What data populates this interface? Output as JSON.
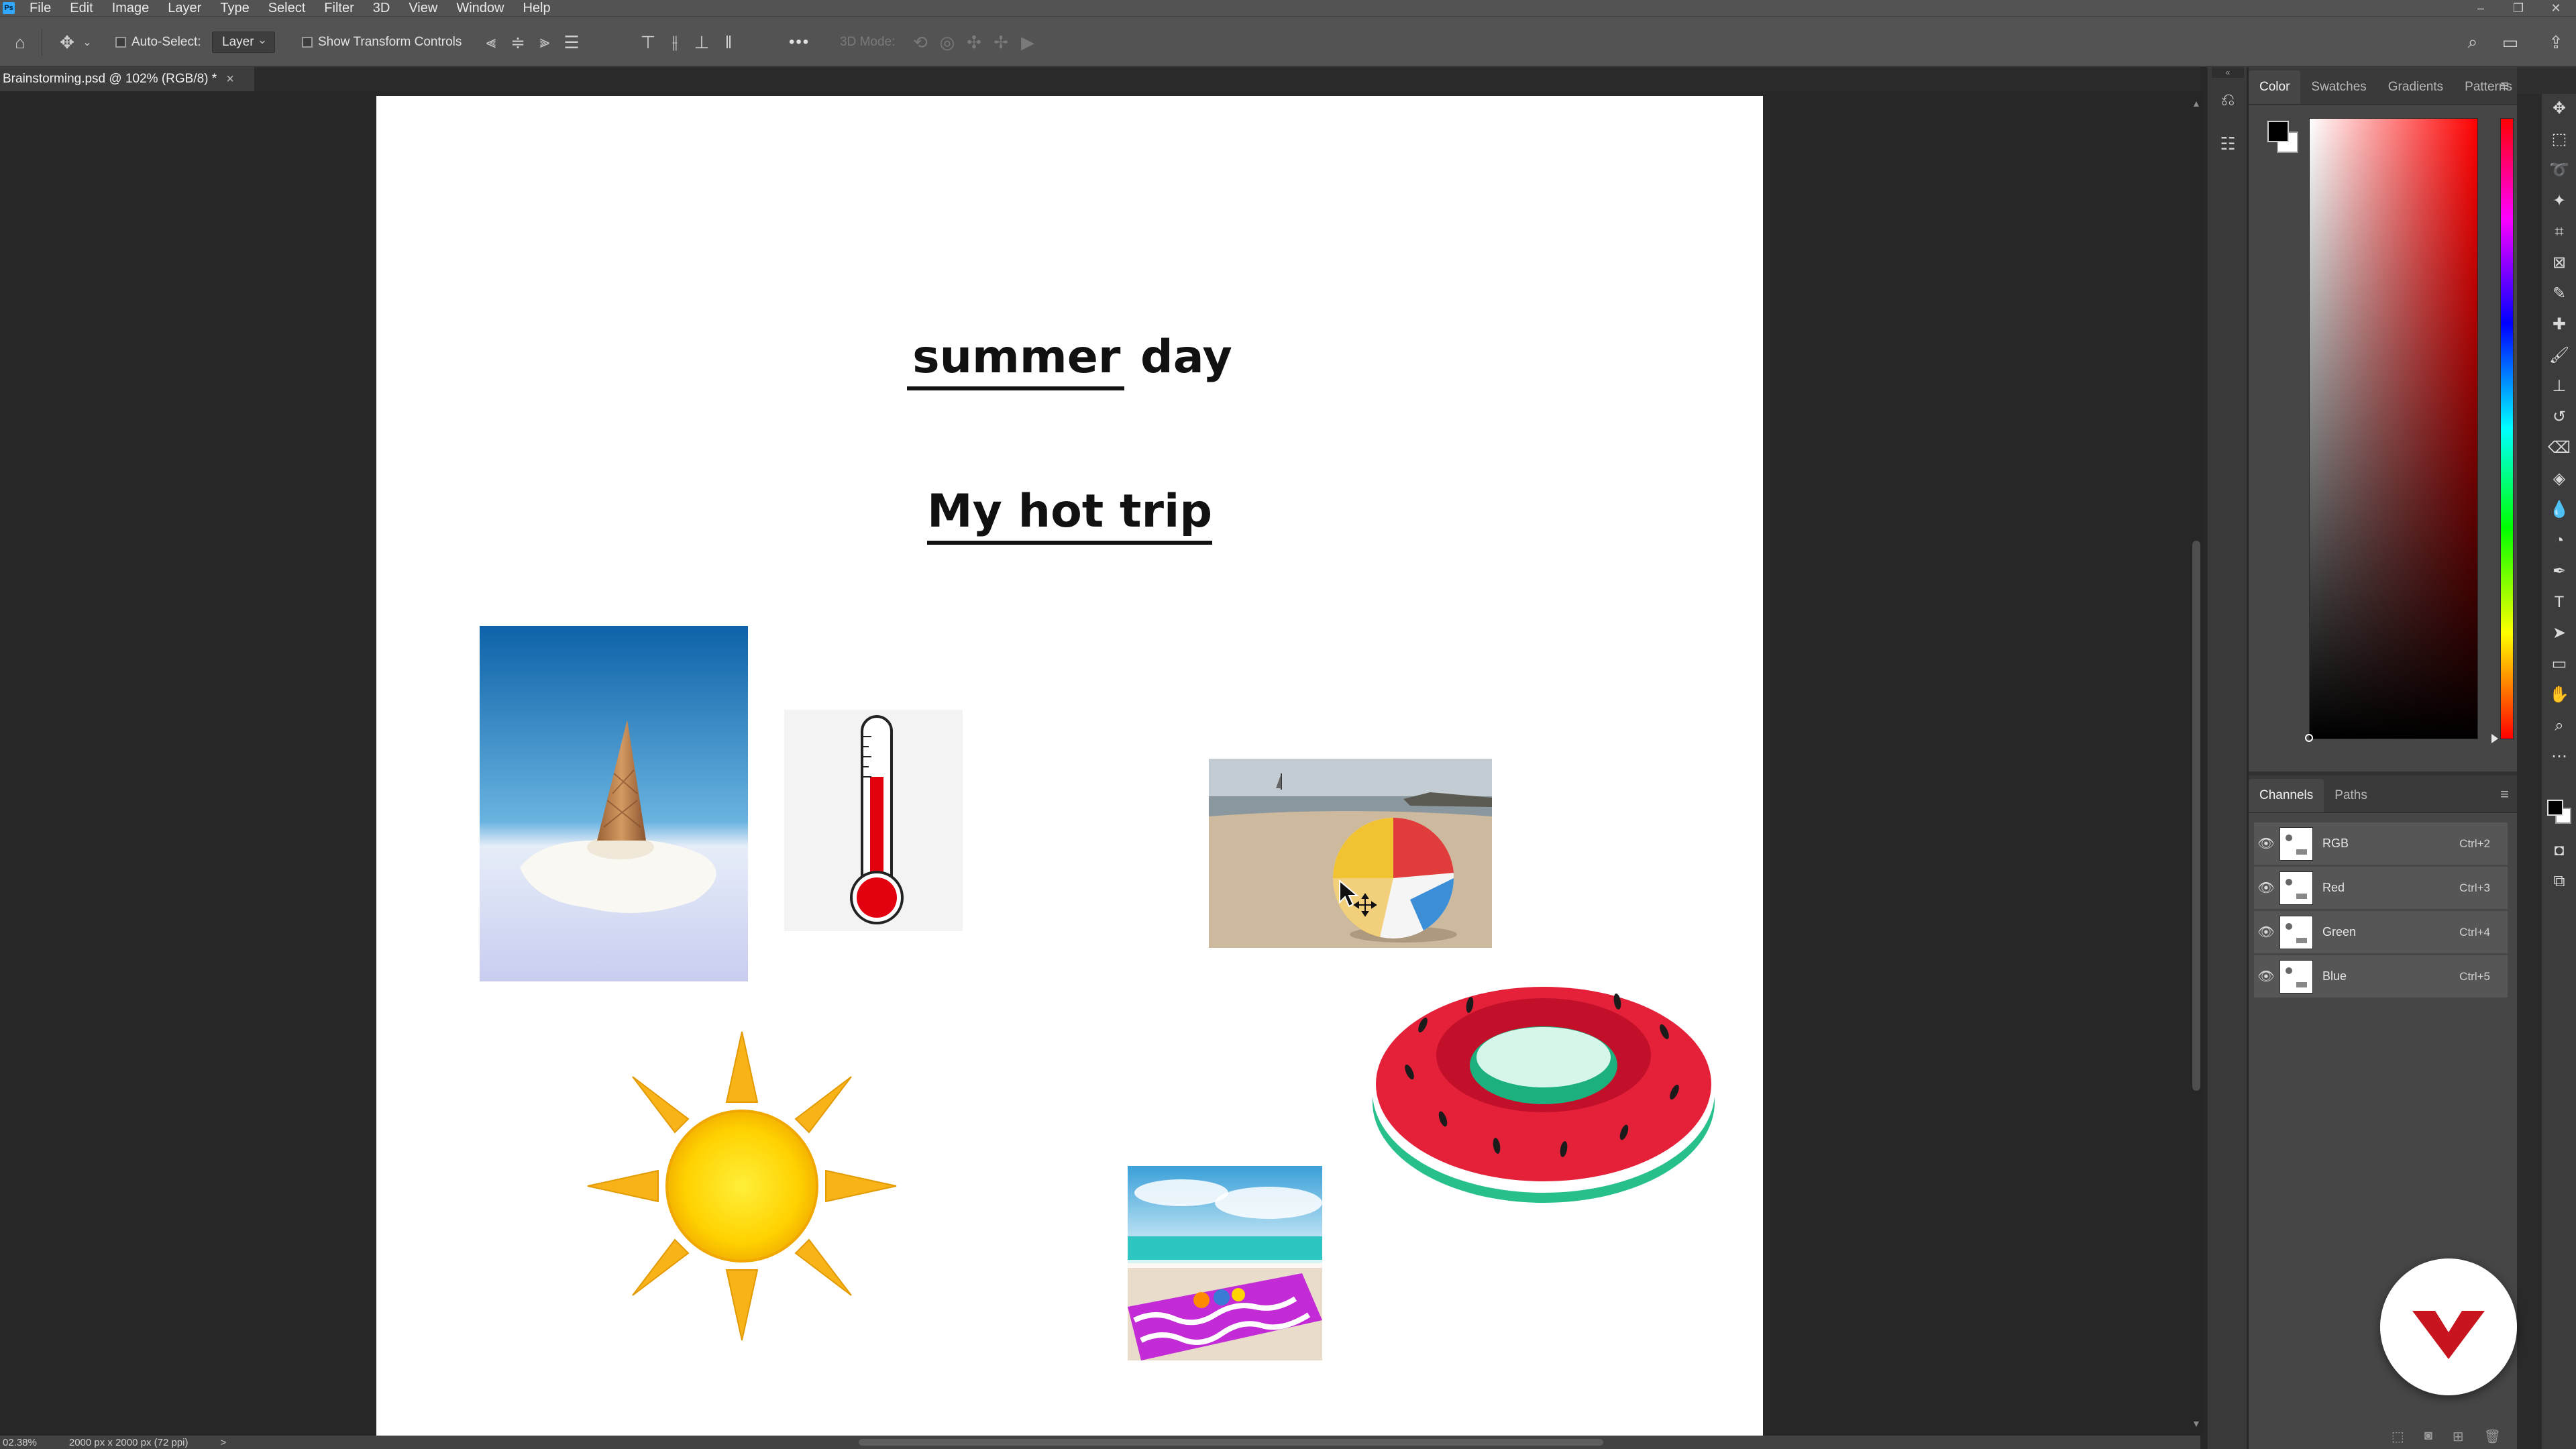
{
  "app": {
    "menu": [
      "File",
      "Edit",
      "Image",
      "Layer",
      "Type",
      "Select",
      "Filter",
      "3D",
      "View",
      "Window",
      "Help"
    ]
  },
  "options": {
    "auto_select_label": "Auto-Select:",
    "layer_dropdown": "Layer",
    "transform_label": "Show Transform Controls",
    "more": "•••",
    "mode_3d": "3D Mode:"
  },
  "document": {
    "tab_title": "Brainstorming.psd @ 102% (RGB/8) *",
    "close": "×",
    "title_underlined": "summer",
    "title_rest": " day",
    "subtitle": "My hot trip"
  },
  "status": {
    "zoom": "02.38%",
    "doc_size": "2000 px x 2000 px (72 ppi)",
    "arrow": ">"
  },
  "color_panel": {
    "tabs": [
      "Color",
      "Swatches",
      "Gradients",
      "Patterns"
    ],
    "active_tab": "Color",
    "foreground": "#000000",
    "background": "#ffffff",
    "hue": "#ff0000"
  },
  "channels_panel": {
    "tabs": [
      "Channels",
      "Paths"
    ],
    "active_tab": "Channels",
    "rows": [
      {
        "name": "RGB",
        "shortcut": "Ctrl+2"
      },
      {
        "name": "Red",
        "shortcut": "Ctrl+3"
      },
      {
        "name": "Green",
        "shortcut": "Ctrl+4"
      },
      {
        "name": "Blue",
        "shortcut": "Ctrl+5"
      }
    ]
  }
}
